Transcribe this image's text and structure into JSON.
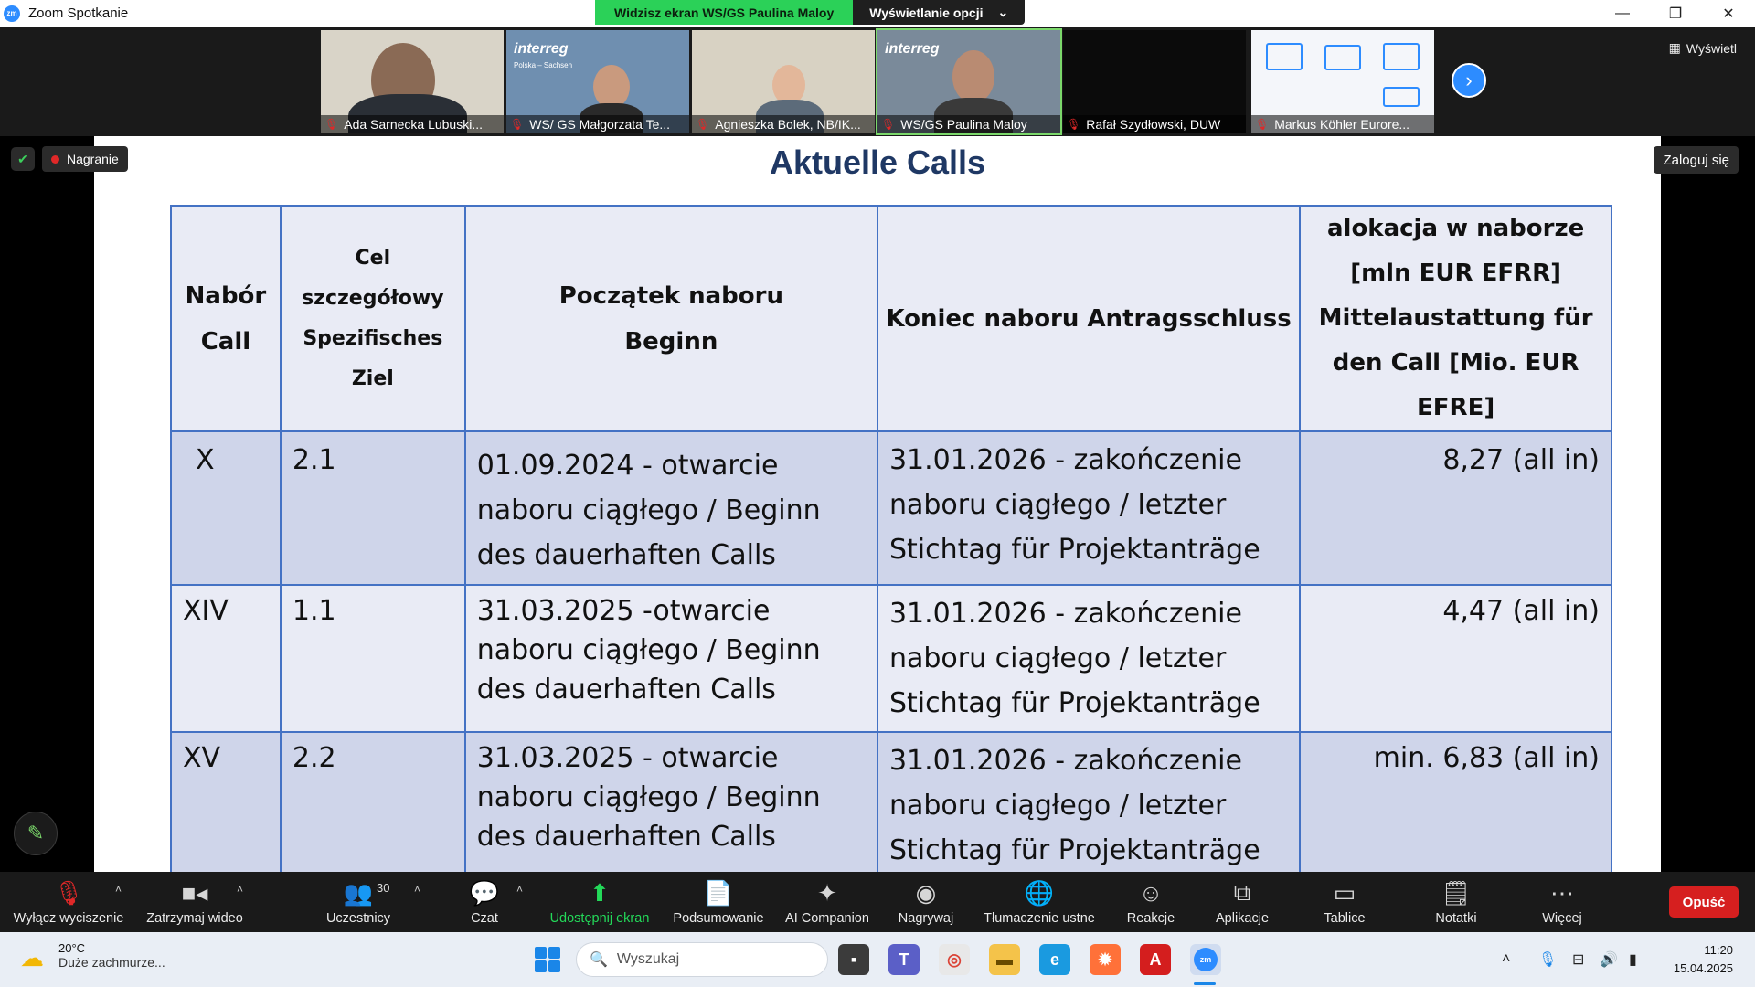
{
  "window": {
    "title": "Zoom Spotkanie",
    "app_icon": "zm",
    "controls": [
      "—",
      "❐",
      "✕"
    ]
  },
  "share_banner": {
    "status": "Widzisz ekran WS/GS Paulina Maloy",
    "options_label": "Wyświetlanie opcji"
  },
  "gallery": {
    "view_label": "Wyświetl",
    "participants": [
      {
        "name": "Ada Sarnecka Lubuski..."
      },
      {
        "name": "WS/ GS Małgorzata Te..."
      },
      {
        "name": "Agnieszka Bolek, NB/IK..."
      },
      {
        "name": "WS/GS Paulina Maloy"
      },
      {
        "name": "Rafał Szydłowski, DUW"
      },
      {
        "name": "Markus Köhler Eurore..."
      }
    ],
    "interreg_logo": "interreg",
    "interreg_sub": "Polska – Sachsen"
  },
  "meeting": {
    "recording_label": "Nagranie",
    "login_label": "Zaloguj się"
  },
  "slide": {
    "title": "Aktuelle Calls",
    "headers": {
      "call": [
        "Nabór",
        "Call"
      ],
      "goal": [
        "Cel szczegółowy",
        "Spezifisches Ziel"
      ],
      "start": [
        "Początek naboru",
        "Beginn"
      ],
      "end": "Koniec naboru Antragsschluss",
      "alloc": [
        "alokacja w naborze",
        "[mln EUR EFRR]",
        "Mittelaustattung für",
        "den Call  [Mio. EUR",
        "EFRE]"
      ]
    },
    "rows": [
      {
        "call": "X",
        "goal": "2.1",
        "start": "01.09.2024 - otwarcie naboru ciągłego / Beginn des dauerhaften Calls",
        "end": "31.01.2026 - zakończenie naboru ciągłego / letzter Stichtag für Projektanträge",
        "alloc": "8,27 (all in)"
      },
      {
        "call": "XIV",
        "goal": "1.1",
        "start": "31.03.2025 -otwarcie naboru ciągłego / Beginn des dauerhaften Calls",
        "end": "31.01.2026 - zakończenie naboru ciągłego / letzter Stichtag für Projektanträge",
        "alloc": "4,47 (all in)"
      },
      {
        "call": "XV",
        "goal": "2.2",
        "start": "31.03.2025 - otwarcie naboru ciągłego / Beginn des dauerhaften Calls",
        "end": "31.01.2026 - zakończenie naboru ciągłego / letzter Stichtag für Projektanträge",
        "alloc": "min. 6,83 (all in)"
      }
    ]
  },
  "toolbar": {
    "mute": "Wyłącz wyciszenie",
    "video": "Zatrzymaj wideo",
    "participants": "Uczestnicy",
    "participants_count": "30",
    "chat": "Czat",
    "share": "Udostępnij ekran",
    "summary": "Podsumowanie",
    "ai": "AI Companion",
    "record": "Nagrywaj",
    "translate": "Tłumaczenie ustne",
    "reactions": "Reakcje",
    "apps": "Aplikacje",
    "boards": "Tablice",
    "notes": "Notatki",
    "more": "Więcej",
    "leave": "Opuść"
  },
  "taskbar": {
    "temperature": "20°C",
    "weather": "Duże zachmurze...",
    "search_placeholder": "Wyszukaj",
    "time": "11:20",
    "date": "15.04.2025"
  },
  "colors": {
    "zoom_blue": "#2d8cff",
    "share_green": "#23d959",
    "leave_red": "#d61f1f",
    "slide_title": "#1f3864",
    "table_border": "#4472c4",
    "table_row_dark": "#cfd5ea",
    "table_row_light": "#e9ebf5"
  }
}
